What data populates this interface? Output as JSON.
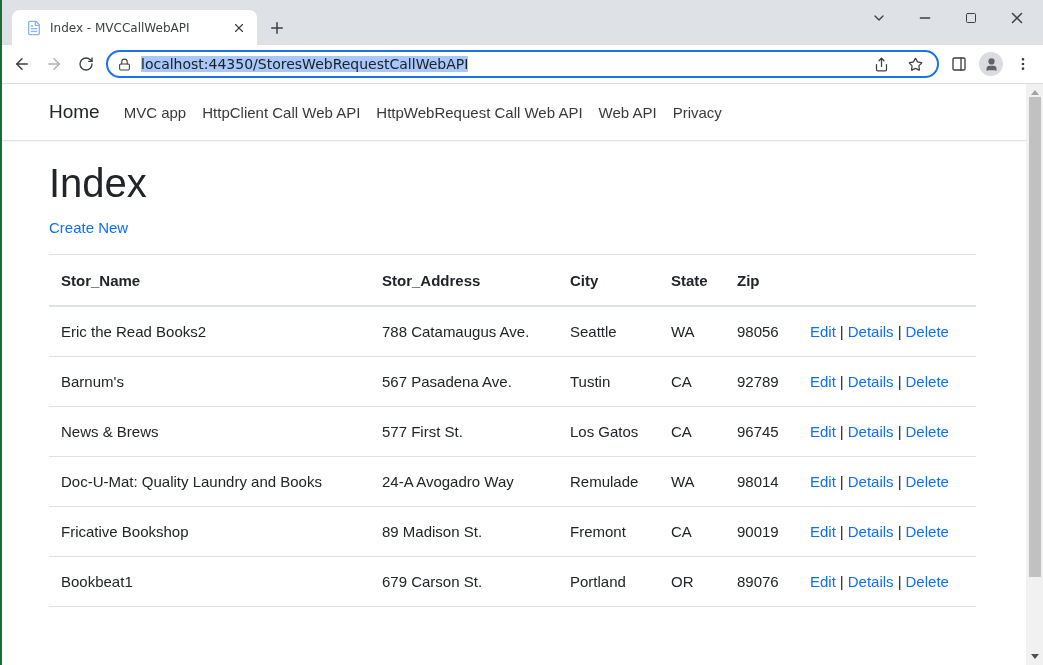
{
  "browser": {
    "tab": {
      "title": "Index - MVCCallWebAPI",
      "selected": true
    },
    "address_bar": {
      "url": "localhost:44350/StoresWebRequestCallWebAPI",
      "text_selected": true
    }
  },
  "navbar": {
    "brand": "Home",
    "links": [
      "MVC app",
      "HttpClient Call Web API",
      "HttpWebRequest Call Web API",
      "Web API",
      "Privacy"
    ]
  },
  "page": {
    "heading": "Index",
    "create_link": "Create New"
  },
  "table": {
    "columns": [
      "Stor_Name",
      "Stor_Address",
      "City",
      "State",
      "Zip"
    ],
    "rows": [
      {
        "cells": [
          "Eric the Read Books2",
          "788 Catamaugus Ave.",
          "Seattle",
          "WA",
          "98056"
        ],
        "links": [
          "Edit",
          "Details",
          "Delete"
        ],
        "separator": "|"
      },
      {
        "cells": [
          "Barnum's",
          "567 Pasadena Ave.",
          "Tustin",
          "CA",
          "92789"
        ],
        "links": [
          "Edit",
          "Details",
          "Delete"
        ],
        "separator": "|"
      },
      {
        "cells": [
          "News & Brews",
          "577 First St.",
          "Los Gatos",
          "CA",
          "96745"
        ],
        "links": [
          "Edit",
          "Details",
          "Delete"
        ],
        "separator": "|"
      },
      {
        "cells": [
          "Doc-U-Mat: Quality Laundry and Books",
          "24-A Avogadro Way",
          "Remulade",
          "WA",
          "98014"
        ],
        "links": [
          "Edit",
          "Details",
          "Delete"
        ],
        "separator": "|"
      },
      {
        "cells": [
          "Fricative Bookshop",
          "89 Madison St.",
          "Fremont",
          "CA",
          "90019"
        ],
        "links": [
          "Edit",
          "Details",
          "Delete"
        ],
        "separator": "|"
      },
      {
        "cells": [
          "Bookbeat1",
          "679 Carson St.",
          "Portland",
          "OR",
          "89076"
        ],
        "links": [
          "Edit",
          "Details",
          "Delete"
        ],
        "separator": "|"
      }
    ]
  }
}
